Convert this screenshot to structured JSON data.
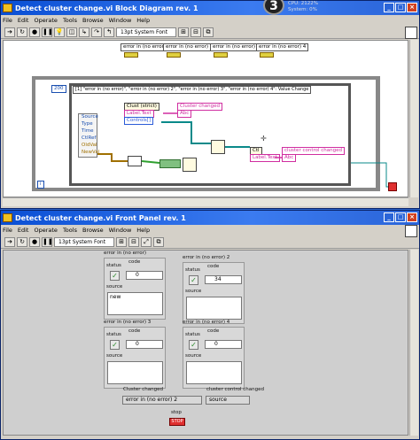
{
  "bd": {
    "title": "Detect cluster change.vi Block Diagram rev. 1",
    "menu": [
      "File",
      "Edit",
      "Operate",
      "Tools",
      "Browse",
      "Window",
      "Help"
    ],
    "font": "13pt System Font",
    "overlay": {
      "big_number": "3",
      "line1": "CPU: 2122%",
      "line2": "System: 0%"
    },
    "error_consts": [
      "error in (no error)",
      "error in (no error) 2",
      "error in (no error) 3",
      "error in (no error) 4"
    ],
    "loop_count": "200",
    "event_case": "[1] \"error in (no error)\", \"error in (no error) 2\", \"error in (no error) 3\", \"error in (no error) 4\": Value Change",
    "event_items": [
      "Source",
      "Type",
      "Time",
      "CtlRef",
      "OldVal",
      "NewVal"
    ],
    "prop_node": {
      "header": "Clust (strict)",
      "items": [
        "Label.Text",
        "Controls[]"
      ]
    },
    "cluster_changed": "Cluster changed",
    "prop_node2": {
      "header": "Ctl",
      "items": [
        "Label.Text"
      ]
    },
    "cluster_control_changed": "cluster  control changed",
    "iter": "i"
  },
  "fp": {
    "title": "Detect cluster change.vi Front Panel rev. 1",
    "menu": [
      "File",
      "Edit",
      "Operate",
      "Tools",
      "Browse",
      "Window",
      "Help"
    ],
    "font": "13pt System Font",
    "clusters": [
      {
        "title": "error in (no error)",
        "status": "status",
        "code_label": "code",
        "code": "0",
        "source_label": "source",
        "source": "new"
      },
      {
        "title": "error in (no error) 2",
        "status": "status",
        "code_label": "code",
        "code": "34",
        "source_label": "source",
        "source": ""
      },
      {
        "title": "error in (no error) 3",
        "status": "status",
        "code_label": "code",
        "code": "0",
        "source_label": "source",
        "source": ""
      },
      {
        "title": "error in (no error) 4",
        "status": "status",
        "code_label": "code",
        "code": "0",
        "source_label": "source",
        "source": ""
      }
    ],
    "cluster_changed_label": "Cluster changed",
    "cluster_changed_value": "error in (no error) 2",
    "cluster_control_changed_label": "cluster  control changed",
    "cluster_control_changed_value": "source",
    "stop_label": "stop",
    "stop_button": "STOP"
  }
}
